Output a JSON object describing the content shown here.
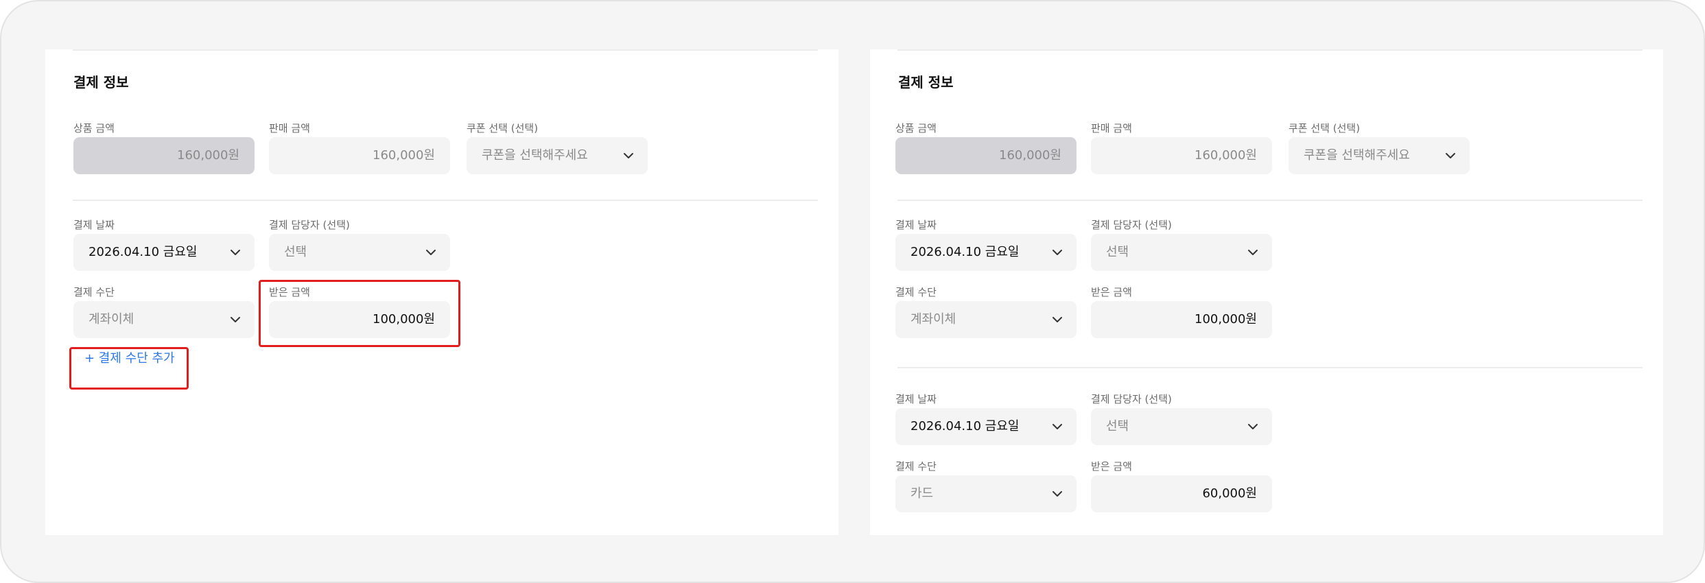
{
  "left": {
    "title": "결제 정보",
    "product_amount": {
      "label": "상품 금액",
      "value": "160,000원"
    },
    "sale_amount": {
      "label": "판매 금액",
      "value": "160,000원"
    },
    "coupon": {
      "label": "쿠폰  선택 (선택)",
      "placeholder": "쿠폰을 선택해주세요"
    },
    "payments": [
      {
        "date_label": "결제 날짜",
        "date": "2026.04.10 금요일",
        "manager_label": "결제 담당자 (선택)",
        "manager": "선택",
        "method_label": "결제 수단",
        "method": "계좌이체",
        "received_label": "받은 금액",
        "received": "100,000원"
      }
    ],
    "add_payment_label": "+ 결제 수단 추가"
  },
  "right": {
    "title": "결제 정보",
    "product_amount": {
      "label": "상품 금액",
      "value": "160,000원"
    },
    "sale_amount": {
      "label": "판매 금액",
      "value": "160,000원"
    },
    "coupon": {
      "label": "쿠폰  선택 (선택)",
      "placeholder": "쿠폰을 선택해주세요"
    },
    "payments": [
      {
        "date_label": "결제 날짜",
        "date": "2026.04.10 금요일",
        "manager_label": "결제 담당자 (선택)",
        "manager": "선택",
        "method_label": "결제 수단",
        "method": "계좌이체",
        "received_label": "받은 금액",
        "received": "100,000원"
      },
      {
        "date_label": "결제 날짜",
        "date": "2026.04.10 금요일",
        "manager_label": "결제 담당자 (선택)",
        "manager": "선택",
        "method_label": "결제 수단",
        "method": "카드",
        "received_label": "받은 금액",
        "received": "60,000원"
      }
    ]
  },
  "colors": {
    "highlight": "#e11d1d",
    "link": "#2b78e4",
    "disabled_field": "#d4d4d8",
    "field": "#f4f4f4"
  },
  "icons": {
    "dropdown": "chevron-down-icon"
  }
}
